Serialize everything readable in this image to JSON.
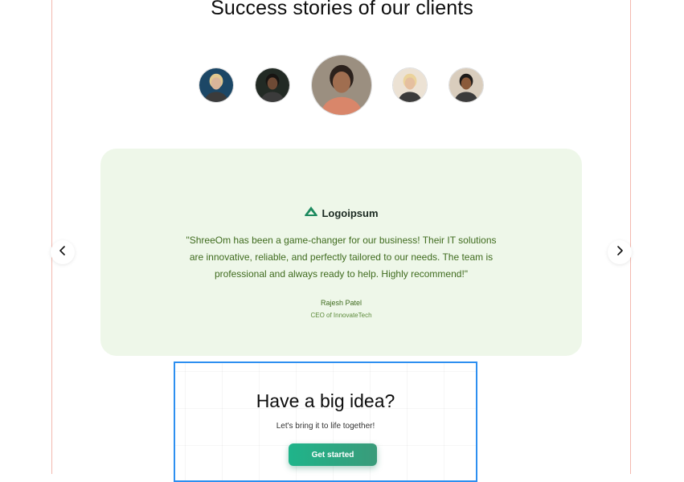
{
  "section": {
    "title": "Success stories of our clients"
  },
  "avatars": [
    {
      "name": "client-avatar-1",
      "bg": "#1c4766",
      "face": "#d9b59a",
      "hair": "#e2c98f"
    },
    {
      "name": "client-avatar-2",
      "bg": "#222a24",
      "face": "#6e4a35",
      "hair": "#171412"
    },
    {
      "name": "client-avatar-3",
      "bg": "#9b8f80",
      "face": "#a06e50",
      "hair": "#2b211c",
      "active": true
    },
    {
      "name": "client-avatar-4",
      "bg": "#ece2d4",
      "face": "#e5bf9f",
      "hair": "#ebd39b"
    },
    {
      "name": "client-avatar-5",
      "bg": "#d9cdbd",
      "face": "#8b5a3a",
      "hair": "#1d1a18"
    }
  ],
  "testimonial": {
    "logo_text": "Logoipsum",
    "logo_color": "#1d8a5f",
    "quote_lines": [
      "\"ShreeOm has been a game-changer for our business! Their IT solutions",
      "are innovative, reliable, and perfectly tailored to our needs. The team is",
      "professional and always ready to help. Highly recommend!\""
    ],
    "author_name": "Rajesh Patel",
    "author_role": "CEO of InnovateTech"
  },
  "nav": {
    "prev_icon": "chevron-left-icon",
    "next_icon": "chevron-right-icon"
  },
  "cta": {
    "title": "Have a big idea?",
    "subtitle": "Let's bring it to life together!",
    "button_label": "Get started"
  },
  "colors": {
    "card_bg": "#eef7e9",
    "quote_text": "#3f6b1e",
    "accent": "#1fb48a",
    "cta_border": "#2d8ff0",
    "frame_line": "#f3b8ae"
  }
}
